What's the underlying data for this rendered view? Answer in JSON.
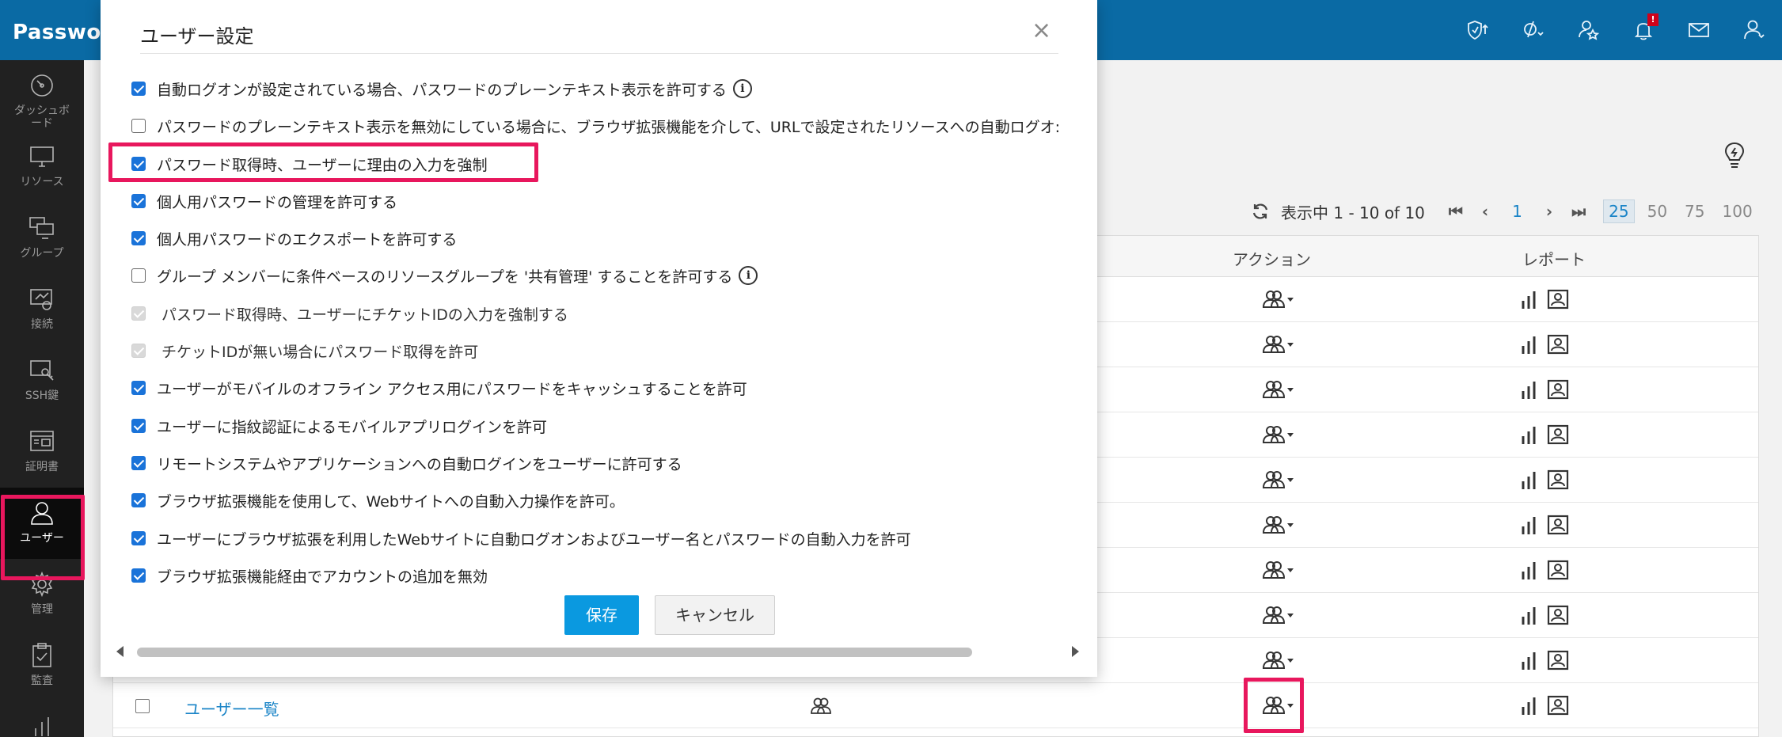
{
  "app": {
    "brand": "Password"
  },
  "sidebar": {
    "items": [
      {
        "label": "ダッシュボード"
      },
      {
        "label": "リソース"
      },
      {
        "label": "グループ"
      },
      {
        "label": "接続"
      },
      {
        "label": "SSH鍵"
      },
      {
        "label": "証明書"
      },
      {
        "label": "ユーザー"
      },
      {
        "label": "管理"
      },
      {
        "label": "監査"
      }
    ]
  },
  "topbar": {
    "notification_badge": "!"
  },
  "pager": {
    "showing": "表示中 1 - 10 of 10",
    "page": "1",
    "sizes": [
      "25",
      "50",
      "75",
      "100"
    ]
  },
  "table": {
    "headers": {
      "action": "アクション",
      "report": "レポート"
    },
    "last_row_name": "ユーザー一覧"
  },
  "modal": {
    "title": "ユーザー設定",
    "close": "×",
    "options": [
      {
        "label": "自動ログオンが設定されている場合、パスワードのプレーンテキスト表示を許可する",
        "state": "on",
        "info": true
      },
      {
        "label": "パスワードのプレーンテキスト表示を無効にしている場合に、ブラウザ拡張機能を介して、URLで設定されたリソースへの自動ログオ:",
        "state": "off"
      },
      {
        "label": "パスワード取得時、ユーザーに理由の入力を強制",
        "state": "on"
      },
      {
        "label": "個人用パスワードの管理を許可する",
        "state": "on"
      },
      {
        "label": "個人用パスワードのエクスポートを許可する",
        "state": "on"
      },
      {
        "label": "グループ メンバーに条件ベースのリソースグループを '共有管理' することを許可する",
        "state": "off",
        "info": true
      },
      {
        "label": "パスワード取得時、ユーザーにチケットIDの入力を強制する",
        "state": "disabled"
      },
      {
        "label": "チケットIDが無い場合にパスワード取得を許可",
        "state": "disabled"
      },
      {
        "label": "ユーザーがモバイルのオフライン アクセス用にパスワードをキャッシュすることを許可",
        "state": "on"
      },
      {
        "label": "ユーザーに指紋認証によるモバイルアプリログインを許可",
        "state": "on"
      },
      {
        "label": "リモートシステムやアプリケーションへの自動ログインをユーザーに許可する",
        "state": "on"
      },
      {
        "label": "ブラウザ拡張機能を使用して、Webサイトへの自動入力操作を許可。",
        "state": "on"
      },
      {
        "label": "ユーザーにブラウザ拡張を利用したWebサイトに自動ログオンおよびユーザー名とパスワードの自動入力を許可",
        "state": "on"
      },
      {
        "label": "ブラウザ拡張機能経由でアカウントの追加を無効",
        "state": "on"
      }
    ],
    "info_glyph": "i",
    "save_label": "保存",
    "cancel_label": "キャンセル"
  },
  "colors": {
    "topbar": "#0a6aa4",
    "sidebar": "#212121",
    "highlight": "#e8175d",
    "save_button": "#0a99e0",
    "checkbox": "#1a73d9"
  }
}
